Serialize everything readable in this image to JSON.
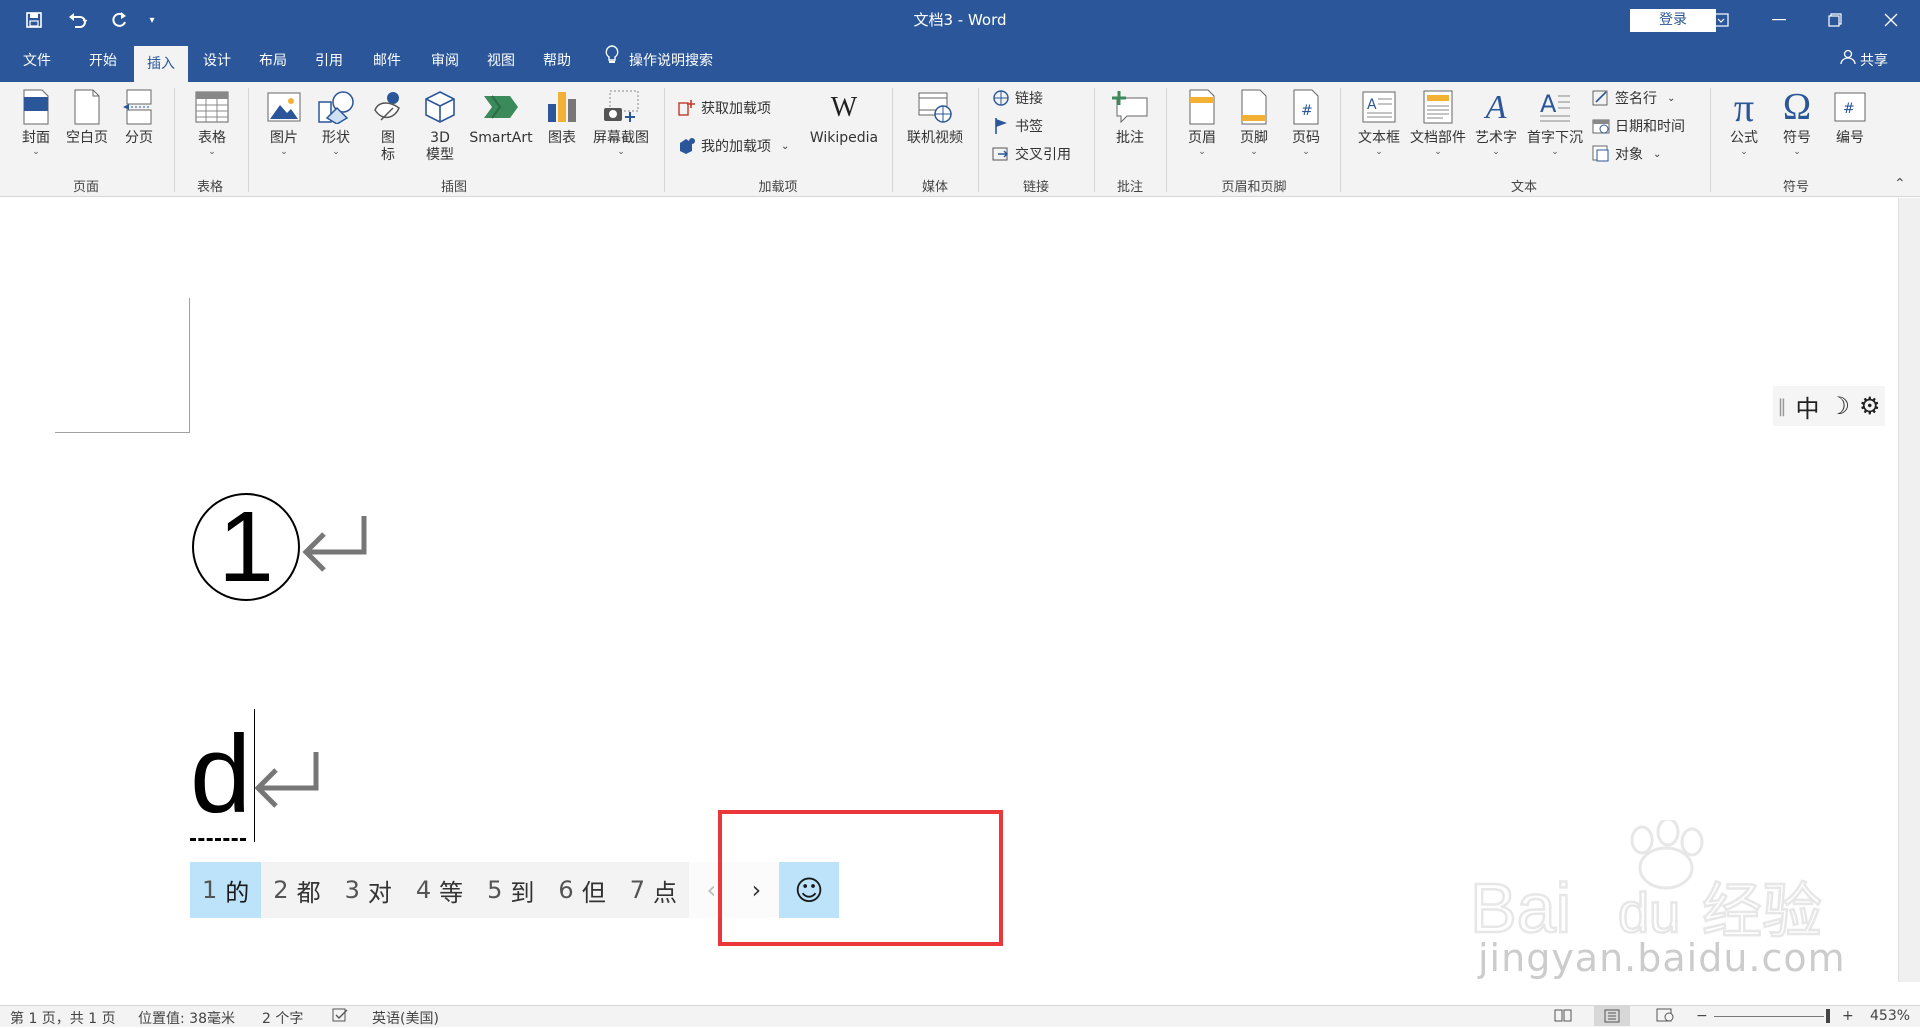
{
  "titlebar": {
    "doc_title": "文档3 - Word",
    "login_label": "登录",
    "save_icon": "save-icon",
    "undo_icon": "undo-icon",
    "redo_icon": "redo-icon"
  },
  "tabs": [
    "文件",
    "开始",
    "插入",
    "设计",
    "布局",
    "引用",
    "邮件",
    "审阅",
    "视图",
    "帮助"
  ],
  "active_tab": "插入",
  "tell_me": "操作说明搜索",
  "share": "共享",
  "ribbon": {
    "pages": {
      "cover": "封面",
      "blank": "空白页",
      "break": "分页",
      "group": "页面"
    },
    "tables": {
      "table": "表格",
      "group": "表格"
    },
    "illustrations": {
      "picture": "图片",
      "shapes": "形状",
      "icons_line1": "图",
      "icons_line2": "标",
      "model_line1": "3D",
      "model_line2": "模型",
      "smartart": "SmartArt",
      "chart": "图表",
      "screenshot": "屏幕截图",
      "group": "插图"
    },
    "addins": {
      "get": "获取加载项",
      "mine": "我的加载项",
      "wikipedia": "Wikipedia",
      "group": "加载项"
    },
    "media": {
      "video": "联机视频",
      "group": "媒体"
    },
    "links": {
      "link": "链接",
      "bookmark": "书签",
      "crossref": "交叉引用",
      "group": "链接"
    },
    "comments": {
      "comment": "批注",
      "group": "批注"
    },
    "header_footer": {
      "header": "页眉",
      "footer": "页脚",
      "page_number": "页码",
      "group": "页眉和页脚"
    },
    "text": {
      "textbox": "文本框",
      "quickparts": "文档部件",
      "wordart": "艺术字",
      "dropcap": "首字下沉",
      "signature": "签名行",
      "datetime": "日期和时间",
      "object": "对象",
      "group": "文本"
    },
    "symbols": {
      "equation": "公式",
      "symbol": "符号",
      "numbering": "编号",
      "group": "符号"
    }
  },
  "document": {
    "circled_number": "1",
    "typed_text": "d"
  },
  "ime": {
    "candidates": [
      {
        "num": "1",
        "text": "的"
      },
      {
        "num": "2",
        "text": "都"
      },
      {
        "num": "3",
        "text": "对"
      },
      {
        "num": "4",
        "text": "等"
      },
      {
        "num": "5",
        "text": "到"
      },
      {
        "num": "6",
        "text": "但"
      },
      {
        "num": "7",
        "text": "点"
      }
    ],
    "prev": "‹",
    "next": "›",
    "emoji": "☺",
    "toolbar": {
      "mode": "中",
      "moon": "☽",
      "gear": "⚙"
    }
  },
  "watermark": {
    "brand": "Bai du 经验",
    "url": "jingyan.baidu.com"
  },
  "statusbar": {
    "page": "第 1 页，共 1 页",
    "position": "位置值: 38毫米",
    "words": "2 个字",
    "language": "英语(美国)",
    "zoom": "453%"
  },
  "colors": {
    "accent": "#2b579a",
    "highlight": "#e9373a",
    "candidate_selected": "#bde3fb"
  }
}
